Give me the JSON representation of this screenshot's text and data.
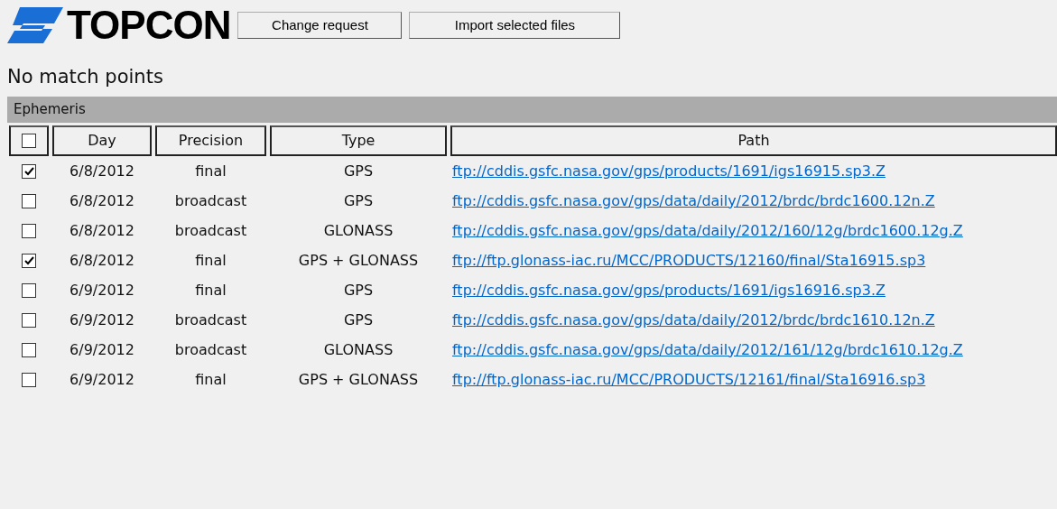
{
  "logo": {
    "text": "TOPCON"
  },
  "buttons": [
    "Change request",
    "Import selected files"
  ],
  "message": "No match points",
  "section": {
    "title": "Ephemeris"
  },
  "table": {
    "select_all": {
      "checked": false
    },
    "columns": [
      "Day",
      "Precision",
      "Type",
      "Path"
    ],
    "rows": [
      {
        "checked": true,
        "day": "6/8/2012",
        "precision": "final",
        "type": "GPS",
        "path": "ftp://cddis.gsfc.nasa.gov/gps/products/1691/igs16915.sp3.Z"
      },
      {
        "checked": false,
        "day": "6/8/2012",
        "precision": "broadcast",
        "type": "GPS",
        "path": "ftp://cddis.gsfc.nasa.gov/gps/data/daily/2012/brdc/brdc1600.12n.Z"
      },
      {
        "checked": false,
        "day": "6/8/2012",
        "precision": "broadcast",
        "type": "GLONASS",
        "path": "ftp://cddis.gsfc.nasa.gov/gps/data/daily/2012/160/12g/brdc1600.12g.Z"
      },
      {
        "checked": true,
        "day": "6/8/2012",
        "precision": "final",
        "type": "GPS + GLONASS",
        "path": "ftp://ftp.glonass-iac.ru/MCC/PRODUCTS/12160/final/Sta16915.sp3"
      },
      {
        "checked": false,
        "day": "6/9/2012",
        "precision": "final",
        "type": "GPS",
        "path": "ftp://cddis.gsfc.nasa.gov/gps/products/1691/igs16916.sp3.Z"
      },
      {
        "checked": false,
        "day": "6/9/2012",
        "precision": "broadcast",
        "type": "GPS",
        "path": "ftp://cddis.gsfc.nasa.gov/gps/data/daily/2012/brdc/brdc1610.12n.Z"
      },
      {
        "checked": false,
        "day": "6/9/2012",
        "precision": "broadcast",
        "type": "GLONASS",
        "path": "ftp://cddis.gsfc.nasa.gov/gps/data/daily/2012/161/12g/brdc1610.12g.Z"
      },
      {
        "checked": false,
        "day": "6/9/2012",
        "precision": "final",
        "type": "GPS + GLONASS",
        "path": "ftp://ftp.glonass-iac.ru/MCC/PRODUCTS/12161/final/Sta16916.sp3"
      }
    ]
  }
}
